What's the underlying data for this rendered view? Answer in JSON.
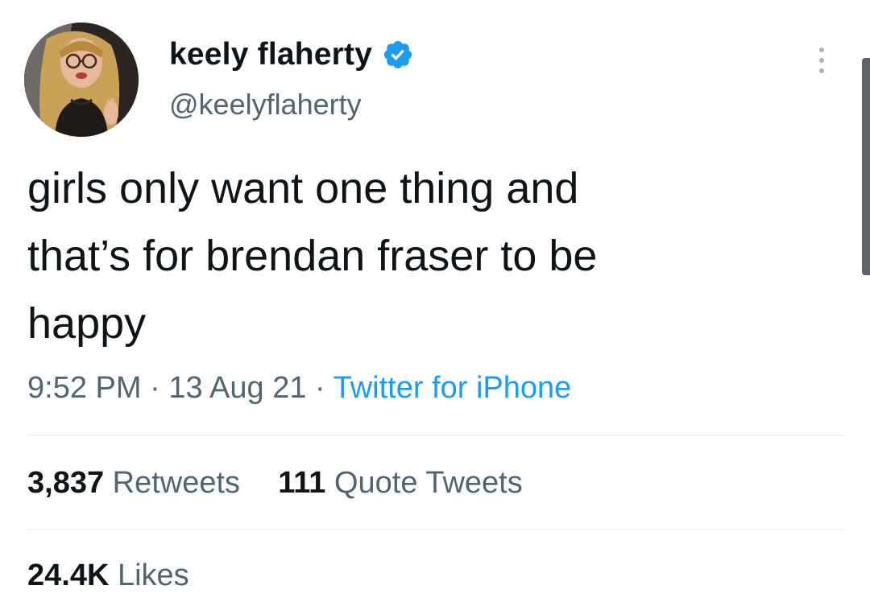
{
  "tweet": {
    "author": {
      "display_name": "keely flaherty",
      "handle": "@keelyflaherty",
      "verified": true,
      "verified_color": "#1d9bf0"
    },
    "text": "girls only want one thing and\nthat’s for brendan fraser to be\nhappy",
    "time": "9:52 PM",
    "separator": "·",
    "date": "13 Aug 21",
    "source": "Twitter for iPhone",
    "stats": {
      "retweets": {
        "count": "3,837",
        "label": "Retweets"
      },
      "quote_tweets": {
        "count": "111",
        "label": "Quote Tweets"
      },
      "likes": {
        "count": "24.4K",
        "label": "Likes"
      }
    }
  },
  "icons": {
    "more": "more-vertical-icon",
    "verified": "verified-badge-icon"
  },
  "colors": {
    "primary_text": "#0f1419",
    "secondary_text": "#536471",
    "link": "#1d9bf0",
    "divider": "#eff3f4"
  }
}
